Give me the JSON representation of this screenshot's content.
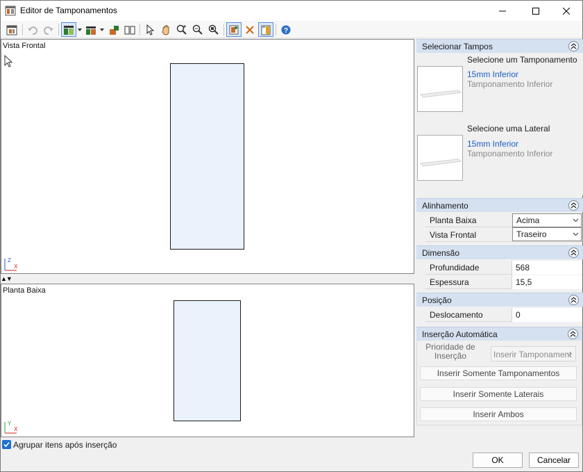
{
  "window": {
    "title": "Editor de Tamponamentos"
  },
  "views": {
    "front_label": "Vista Frontal",
    "plan_label": "Planta Baixa",
    "axis_z": "Z",
    "axis_x": "X",
    "axis_y": "Y",
    "splitter": "▲▼"
  },
  "selection": {
    "header": "Selecionar Tampos",
    "top": {
      "heading": "Selecione um Tamponamento",
      "name": "15mm Inferior",
      "type": "Tamponamento Inferior"
    },
    "side": {
      "heading": "Selecione uma Lateral",
      "name": "15mm Inferior",
      "type": "Tamponamento Inferior"
    }
  },
  "alignment": {
    "header": "Alinhamento",
    "plan_label": "Planta Baixa",
    "plan_value": "Acima",
    "front_label": "Vista Frontal",
    "front_value": "Traseiro"
  },
  "dimension": {
    "header": "Dimensão",
    "depth_label": "Profundidade",
    "depth_value": "568",
    "thickness_label": "Espessura",
    "thickness_value": "15,5"
  },
  "position": {
    "header": "Posição",
    "offset_label": "Deslocamento",
    "offset_value": "0"
  },
  "auto_insert": {
    "header": "Inserção Automática",
    "priority_label_1": "Prioridade de",
    "priority_label_2": "Inserção",
    "priority_value": "Inserir Tamponament",
    "btn_only_tops": "Inserir Somente Tamponamentos",
    "btn_only_sides": "Inserir Somente Laterais",
    "btn_both": "Inserir Ambos"
  },
  "footer": {
    "group_checkbox_label": "Agrupar itens após inserção",
    "group_checked": true,
    "ok": "OK",
    "cancel": "Cancelar"
  },
  "colors": {
    "accent": "#1f6fd0",
    "section_header": "#d5e1f0",
    "link": "#1d5fc4",
    "piece_fill": "#eaf2fc"
  }
}
